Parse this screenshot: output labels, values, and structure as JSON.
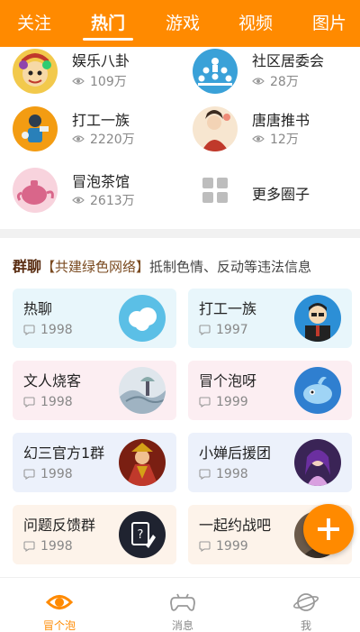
{
  "tabs": [
    "关注",
    "热门",
    "游戏",
    "视频",
    "图片"
  ],
  "circles": [
    {
      "name": "娱乐八卦",
      "views": "109万"
    },
    {
      "name": "社区居委会",
      "views": "28万"
    },
    {
      "name": "打工一族",
      "views": "2220万"
    },
    {
      "name": "唐唐推书",
      "views": "12万"
    },
    {
      "name": "冒泡茶馆",
      "views": "2613万"
    },
    {
      "name": "更多圈子"
    }
  ],
  "group_section": {
    "title": "群聊",
    "notice": "【共建绿色网络】",
    "notice_rest": "抵制色情、反动等违法信息"
  },
  "groups": [
    {
      "name": "热聊",
      "count": "1998"
    },
    {
      "name": "打工一族",
      "count": "1997"
    },
    {
      "name": "文人烧客",
      "count": "1998"
    },
    {
      "name": "冒个泡呀",
      "count": "1999"
    },
    {
      "name": "幻三官方1群",
      "count": "1998"
    },
    {
      "name": "小婵后援团",
      "count": "1998"
    },
    {
      "name": "问题反馈群",
      "count": "1998"
    },
    {
      "name": "一起约战吧",
      "count": "1999"
    }
  ],
  "bottom_nav": [
    "冒个泡",
    "消息",
    "我"
  ],
  "colors": {
    "accent": "#ff8a00"
  }
}
